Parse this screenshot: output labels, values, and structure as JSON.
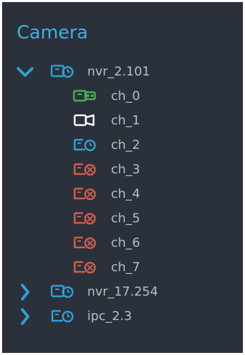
{
  "panel": {
    "title": "Camera"
  },
  "colors": {
    "background": "#2b313a",
    "accent": "#3ab3e4",
    "text": "#b9bec6",
    "status_online": "#2fa0d8",
    "status_recording": "#4caf50",
    "status_idle": "#ffffff",
    "status_offline": "#d35d4f"
  },
  "tree": {
    "nvr_2_101": {
      "label": "nvr_2.101",
      "expanded": true,
      "icon": "camera-online-icon",
      "channels": [
        {
          "label": "ch_0",
          "status": "recording",
          "icon": "camera-recording-icon"
        },
        {
          "label": "ch_1",
          "status": "idle",
          "icon": "camera-idle-icon"
        },
        {
          "label": "ch_2",
          "status": "online",
          "icon": "camera-online-icon"
        },
        {
          "label": "ch_3",
          "status": "offline",
          "icon": "camera-offline-icon"
        },
        {
          "label": "ch_4",
          "status": "offline",
          "icon": "camera-offline-icon"
        },
        {
          "label": "ch_5",
          "status": "offline",
          "icon": "camera-offline-icon"
        },
        {
          "label": "ch_6",
          "status": "offline",
          "icon": "camera-offline-icon"
        },
        {
          "label": "ch_7",
          "status": "offline",
          "icon": "camera-offline-icon"
        }
      ]
    },
    "nvr_17_254": {
      "label": "nvr_17.254",
      "expanded": false,
      "icon": "camera-online-icon"
    },
    "ipc_2_3": {
      "label": "ipc_2.3",
      "expanded": false,
      "icon": "camera-online-icon"
    }
  }
}
